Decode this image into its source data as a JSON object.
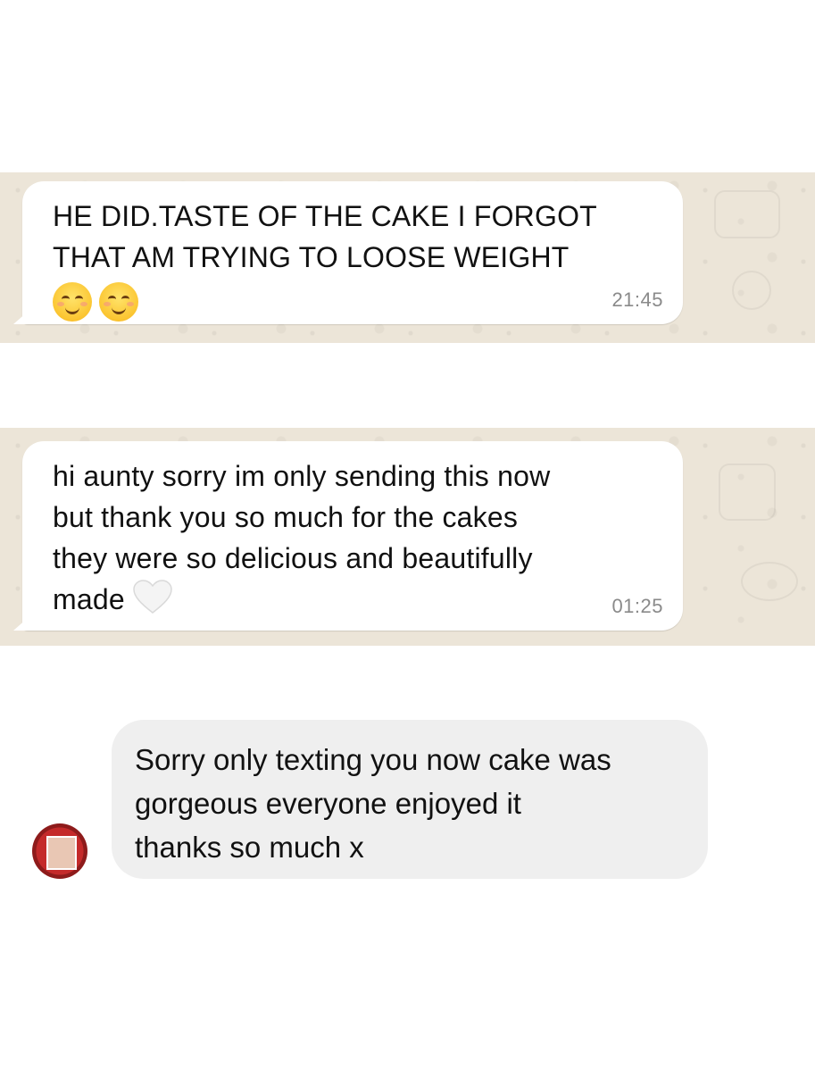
{
  "conversations": [
    {
      "app": "whatsapp",
      "message": {
        "lines": [
          "HE DID.TASTE OF THE CAKE I FORGOT",
          "THAT AM TRYING TO LOOSE WEIGHT"
        ],
        "emoji": [
          "smiling-face-icon",
          "smiling-face-icon"
        ],
        "time": "21:45"
      }
    },
    {
      "app": "whatsapp",
      "message": {
        "lines": [
          "hi aunty sorry im only sending this now",
          "but thank you so much for the cakes",
          "they were so delicious and beautifully",
          "made"
        ],
        "emoji": [
          "white-heart-icon"
        ],
        "time": "01:25"
      }
    },
    {
      "app": "instagram",
      "message": {
        "lines": [
          "Sorry only texting you now cake was",
          "gorgeous everyone enjoyed it",
          "thanks so much x"
        ]
      }
    }
  ],
  "colors": {
    "whatsapp_wallpaper": "#ece5d8",
    "bubble_white": "#ffffff",
    "instagram_bubble": "#efefef",
    "timestamp": "#8a8a8a"
  }
}
